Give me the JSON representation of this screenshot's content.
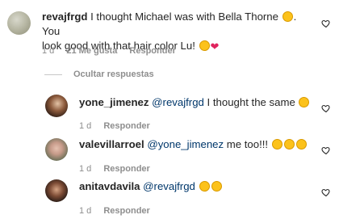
{
  "main_comment": {
    "username": "revajfrgd",
    "text_line1": " I thought Michael was with Bella Thorne ",
    "text_after_emoji": ". You",
    "text_line2": "look good with that hair color Lu! ",
    "time": "1 d",
    "likes": "21 Me gusta",
    "reply_label": "Responder"
  },
  "hide_replies_label": "Ocultar respuestas",
  "replies": [
    {
      "username": "yone_jimenez",
      "mention": "@revajfrgd",
      "text": " I thought the same ",
      "time": "1 d",
      "reply_label": "Responder"
    },
    {
      "username": "valevillarroel",
      "mention": "@yone_jimenez",
      "text": " me too!!! ",
      "time": "1 d",
      "reply_label": "Responder"
    },
    {
      "username": "anitavdavila",
      "mention": "@revajfrgd",
      "text": " ",
      "time": "1 d",
      "reply_label": "Responder"
    }
  ],
  "icons": {
    "like": "heart-outline-icon",
    "emoji_grin": "grinning-squinting-face",
    "emoji_heart_eyes": "smiling-face-with-heart-eyes",
    "emoji_heart": "red-heart"
  },
  "colors": {
    "text": "#262626",
    "meta": "#8e8e8e",
    "mention": "#00376b"
  }
}
